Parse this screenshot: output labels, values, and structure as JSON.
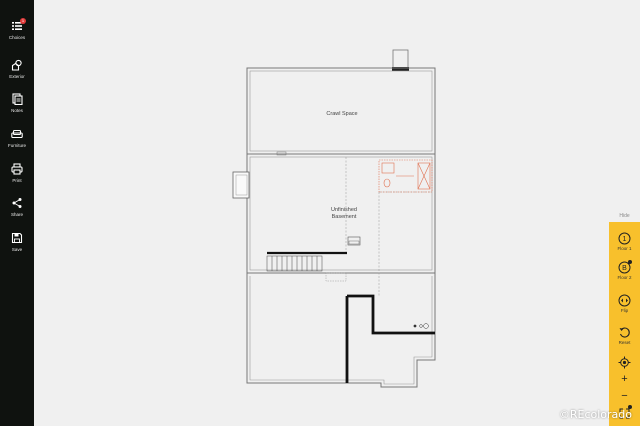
{
  "sidebar": {
    "items": [
      {
        "label": "Choices",
        "icon": "list-icon",
        "badge": "1"
      },
      {
        "label": "Exterior",
        "icon": "exterior-icon"
      },
      {
        "label": "Notes",
        "icon": "notes-icon"
      },
      {
        "label": "Furniture",
        "icon": "sofa-icon"
      },
      {
        "label": "Print",
        "icon": "printer-icon"
      },
      {
        "label": "Share",
        "icon": "share-icon"
      },
      {
        "label": "Save",
        "icon": "save-icon"
      }
    ]
  },
  "plan": {
    "rooms": {
      "crawl_space": "Crawl Space",
      "basement_line1": "Unfinished",
      "basement_line2": "Basement"
    }
  },
  "controls": {
    "hide_label": "Hide",
    "floor1": {
      "label": "Floor 1",
      "number": "1"
    },
    "floor2": {
      "label": "Floor 2",
      "number": "B"
    },
    "flip": "Flip",
    "reset": "Reset",
    "zoom_in": "+",
    "zoom_out": "−"
  },
  "colors": {
    "sidebar_bg": "#0f120f",
    "panel_accent": "#f8c02c",
    "badge": "#e23b3b"
  },
  "watermark": "©REcolorado"
}
